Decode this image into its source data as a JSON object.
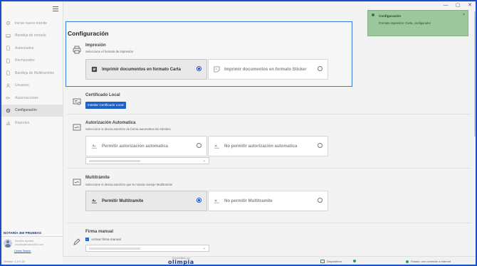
{
  "window": {
    "controls": [
      "—",
      "▢",
      "✕"
    ]
  },
  "sidebar": {
    "items": [
      {
        "label": "Iniciar nuevo trámite",
        "icon": "gear-icon"
      },
      {
        "label": "Bandeja de entrada",
        "icon": "inbox-icon"
      },
      {
        "label": "Autorizados",
        "icon": "document-icon"
      },
      {
        "label": "Rechazados",
        "icon": "document-icon"
      },
      {
        "label": "Bandeja de Multitramites",
        "icon": "document-icon"
      },
      {
        "label": "Usuarios",
        "icon": "user-icon"
      },
      {
        "label": "Autorizaciones",
        "icon": "key-icon"
      },
      {
        "label": "Configuración",
        "icon": "settings-icon",
        "active": true
      },
      {
        "label": "Reportes",
        "icon": "chart-icon"
      }
    ],
    "notary": "NOTARÍA 360 PRUEBAS",
    "user_name": "Nombre Apellido",
    "user_email": "usuario@notaria360.com",
    "logout": "Cerrar Sesión",
    "version": "Versión: 1.0.0.22"
  },
  "page": {
    "title": "Configuración"
  },
  "impresion": {
    "title": "Impresión",
    "desc": "Seleccione el formato de impresión",
    "opt_carta": "Imprimir documentos en formato Carta",
    "opt_sticker": "Imprimir documentos en formato Sticker"
  },
  "certificado": {
    "title": "Certificado Local",
    "button": "Instalar Certificado Local"
  },
  "autorizacion": {
    "title": "Autorización Automatica",
    "desc": "Seleccione si desea autorizar de forma automatica los trámites",
    "opt_yes": "Permitir autorización automatica",
    "opt_no": "No permitir autorización automatica"
  },
  "multitramite": {
    "title": "Multitrámite",
    "desc": "Seleccione si desea autorizar que la notaria maneje Multitramite",
    "opt_yes": "Permitir Multitramite",
    "opt_no": "No permitir Multitramite"
  },
  "firma": {
    "title": "Firma manual",
    "checkbox": "Activar firma manual"
  },
  "status": {
    "developed_by": "Desarrollado por",
    "brand": "olimpia",
    "devices": "Dispositivos",
    "connection": "Estado: con conexión a internet"
  },
  "toast": {
    "title": "Configuración",
    "message": "Formato impresión: Carta, configurado!"
  }
}
